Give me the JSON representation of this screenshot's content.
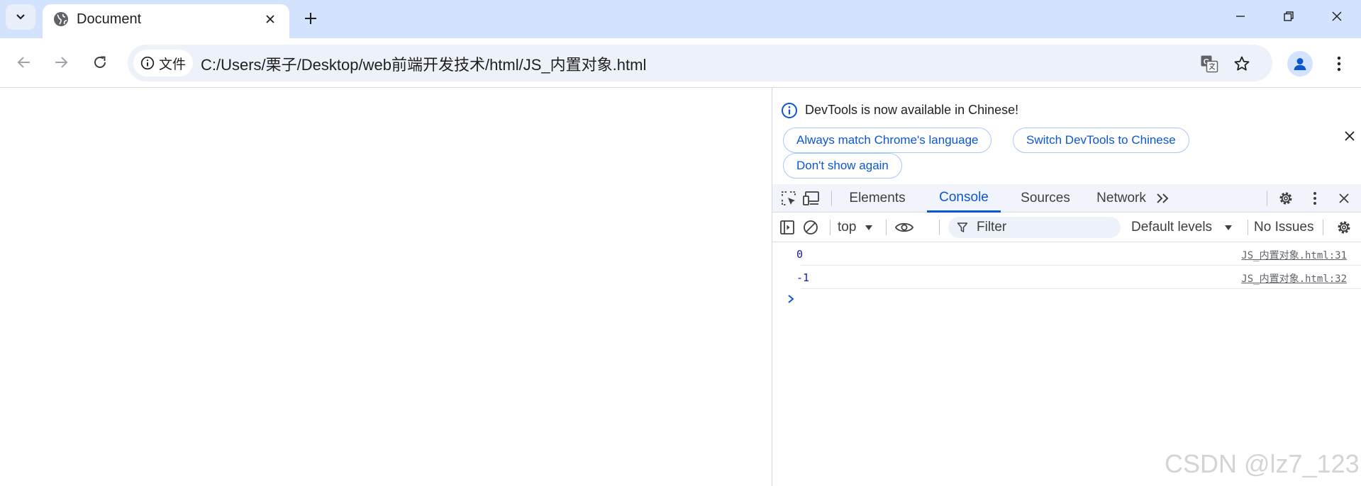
{
  "browser": {
    "tab": {
      "title": "Document"
    },
    "address": {
      "chip_label": "文件",
      "url": "C:/Users/栗子/Desktop/web前端开发技术/html/JS_内置对象.html"
    }
  },
  "devtools": {
    "infobar": {
      "message": "DevTools is now available in Chinese!",
      "btn_match": "Always match Chrome's language",
      "btn_switch": "Switch DevTools to Chinese",
      "btn_dont_show": "Don't show again"
    },
    "tabs": [
      "Elements",
      "Console",
      "Sources",
      "Network"
    ],
    "active_tab": "Console",
    "console_toolbar": {
      "context": "top",
      "filter_placeholder": "Filter",
      "levels": "Default levels",
      "issues": "No Issues"
    },
    "messages": [
      {
        "text": "0",
        "source": "JS_内置对象.html:31"
      },
      {
        "text": "-1",
        "source": "JS_内置对象.html:32"
      }
    ]
  },
  "watermark": "CSDN @lz7_123",
  "colors": {
    "tabstrip": "#d3e3fd",
    "accent": "#0b57d0",
    "console_value": "#1a1aa6"
  }
}
